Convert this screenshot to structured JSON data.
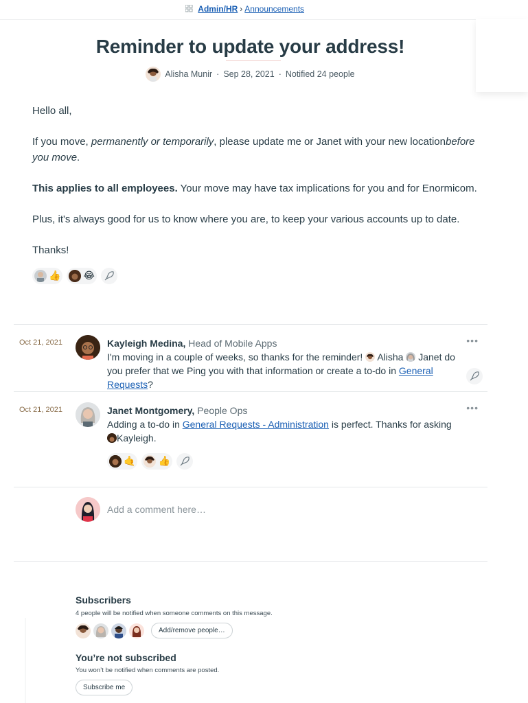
{
  "breadcrumb": {
    "section": "Admin/HR",
    "separator": "›",
    "page": "Announcements"
  },
  "message": {
    "title": "Reminder to update your address!",
    "author": "Alisha Munir",
    "date": "Sep 28, 2021",
    "notified": "Notified 24 people",
    "dot": "·",
    "greeting": "Hello all,",
    "p2_a": "If you move, ",
    "p2_b": "permanently or temporarily",
    "p2_c": ", please update me or Janet with your new location",
    "p2_d": "before you move",
    "p2_e": ".",
    "p3_bold": "This applies to all employees.",
    "p3_rest": " Your move may have tax implications for you and for Enormicom.",
    "p4": "Plus, it's always good for us to know where you are, to keep your various accounts up to date.",
    "p5": "Thanks!",
    "boosts": [
      "👍",
      "😂"
    ]
  },
  "comments": [
    {
      "date": "Oct 21, 2021",
      "author": "Kayleigh Medina,",
      "role": " Head of Mobile Apps",
      "text_a": "I'm moving in a couple of weeks, so thanks for the reminder! ",
      "mention1": "Alisha",
      "mention2": "Janet",
      "text_b": " do you prefer that we Ping you with that information or create a to-do in ",
      "link": "General Requests",
      "text_c": "?",
      "more": "•••"
    },
    {
      "date": "Oct 21, 2021",
      "author": "Janet Montgomery,",
      "role": " People Ops",
      "text_a": "Adding a to-do in ",
      "link": "General Requests - Administration",
      "text_b": " is perfect. Thanks for asking ",
      "mention": "Kayleigh.",
      "more": "•••",
      "boosts": [
        "🤙",
        "👍"
      ]
    }
  ],
  "composer": {
    "placeholder": "Add a comment here…"
  },
  "subscribers": {
    "title": "Subscribers",
    "note": "4 people will be notified when someone comments on this message.",
    "button": "Add/remove people…"
  },
  "subscription": {
    "title": "You’re not subscribed",
    "note": "You won’t be notified when comments are posted.",
    "button": "Subscribe me"
  },
  "colors": {
    "link": "#1a5fb4",
    "date": "#8a6e4b",
    "text": "#283c46"
  }
}
